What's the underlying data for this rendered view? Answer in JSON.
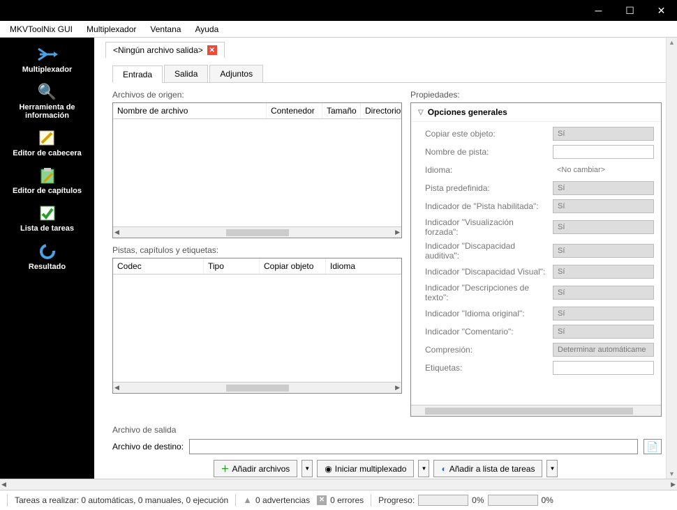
{
  "menubar": {
    "app": "MKVToolNix GUI",
    "multiplexor": "Multiplexador",
    "window": "Ventana",
    "help": "Ayuda"
  },
  "sidebar": {
    "items": [
      {
        "label": "Multiplexador"
      },
      {
        "label": "Herramienta de información"
      },
      {
        "label": "Editor de cabecera"
      },
      {
        "label": "Editor de capítulos"
      },
      {
        "label": "Lista de tareas"
      },
      {
        "label": "Resultado"
      }
    ]
  },
  "doc_tab": {
    "title": "<Ningún archivo salida>"
  },
  "inner_tabs": {
    "entrada": "Entrada",
    "salida": "Salida",
    "adjuntos": "Adjuntos"
  },
  "sections": {
    "sources": "Archivos de origen:",
    "tracks": "Pistas, capítulos y etiquetas:",
    "properties": "Propiedades:",
    "output_file_section": "Archivo de salida",
    "output_dest": "Archivo de destino:"
  },
  "src_cols": {
    "filename": "Nombre de archivo",
    "container": "Contenedor",
    "size": "Tamaño",
    "directory": "Directorio"
  },
  "track_cols": {
    "codec": "Codec",
    "type": "Tipo",
    "copy": "Copiar objeto",
    "language": "Idioma"
  },
  "props": {
    "header": "Opciones generales",
    "rows": [
      {
        "label": "Copiar este objeto:",
        "value": "Sí",
        "style": "grey"
      },
      {
        "label": "Nombre de pista:",
        "value": "",
        "style": "white"
      },
      {
        "label": "Idioma:",
        "value": "<No cambiar>",
        "style": "plain"
      },
      {
        "label": "Pista predefinida:",
        "value": "Sí",
        "style": "grey"
      },
      {
        "label": "Indicador de \"Pista habilitada\":",
        "value": "Sí",
        "style": "grey"
      },
      {
        "label": "Indicador \"Visualización forzada\":",
        "value": "Sí",
        "style": "grey"
      },
      {
        "label": "Indicador \"Discapacidad auditiva\":",
        "value": "Sí",
        "style": "grey"
      },
      {
        "label": "Indicador \"Discapacidad Visual\":",
        "value": "Sí",
        "style": "grey"
      },
      {
        "label": "Indicador \"Descripciones de texto\":",
        "value": "Sí",
        "style": "grey"
      },
      {
        "label": "Indicador \"Idioma original\":",
        "value": "Sí",
        "style": "grey"
      },
      {
        "label": "Indicador \"Comentario\":",
        "value": "Sí",
        "style": "grey"
      },
      {
        "label": "Compresión:",
        "value": "Determinar automáticame",
        "style": "grey"
      },
      {
        "label": "Etiquetas:",
        "value": "",
        "style": "white"
      }
    ]
  },
  "actions": {
    "add_files": "Añadir archivos",
    "start_mux": "Iniciar multiplexado",
    "add_queue": "Añadir a lista de tareas"
  },
  "status": {
    "tasks": "Tareas a realizar:  0 automáticas, 0 manuales, 0 ejecución",
    "warnings": "0 advertencias",
    "errors": "0 errores",
    "progress_label": "Progreso:",
    "pct1": "0%",
    "pct2": "0%"
  }
}
